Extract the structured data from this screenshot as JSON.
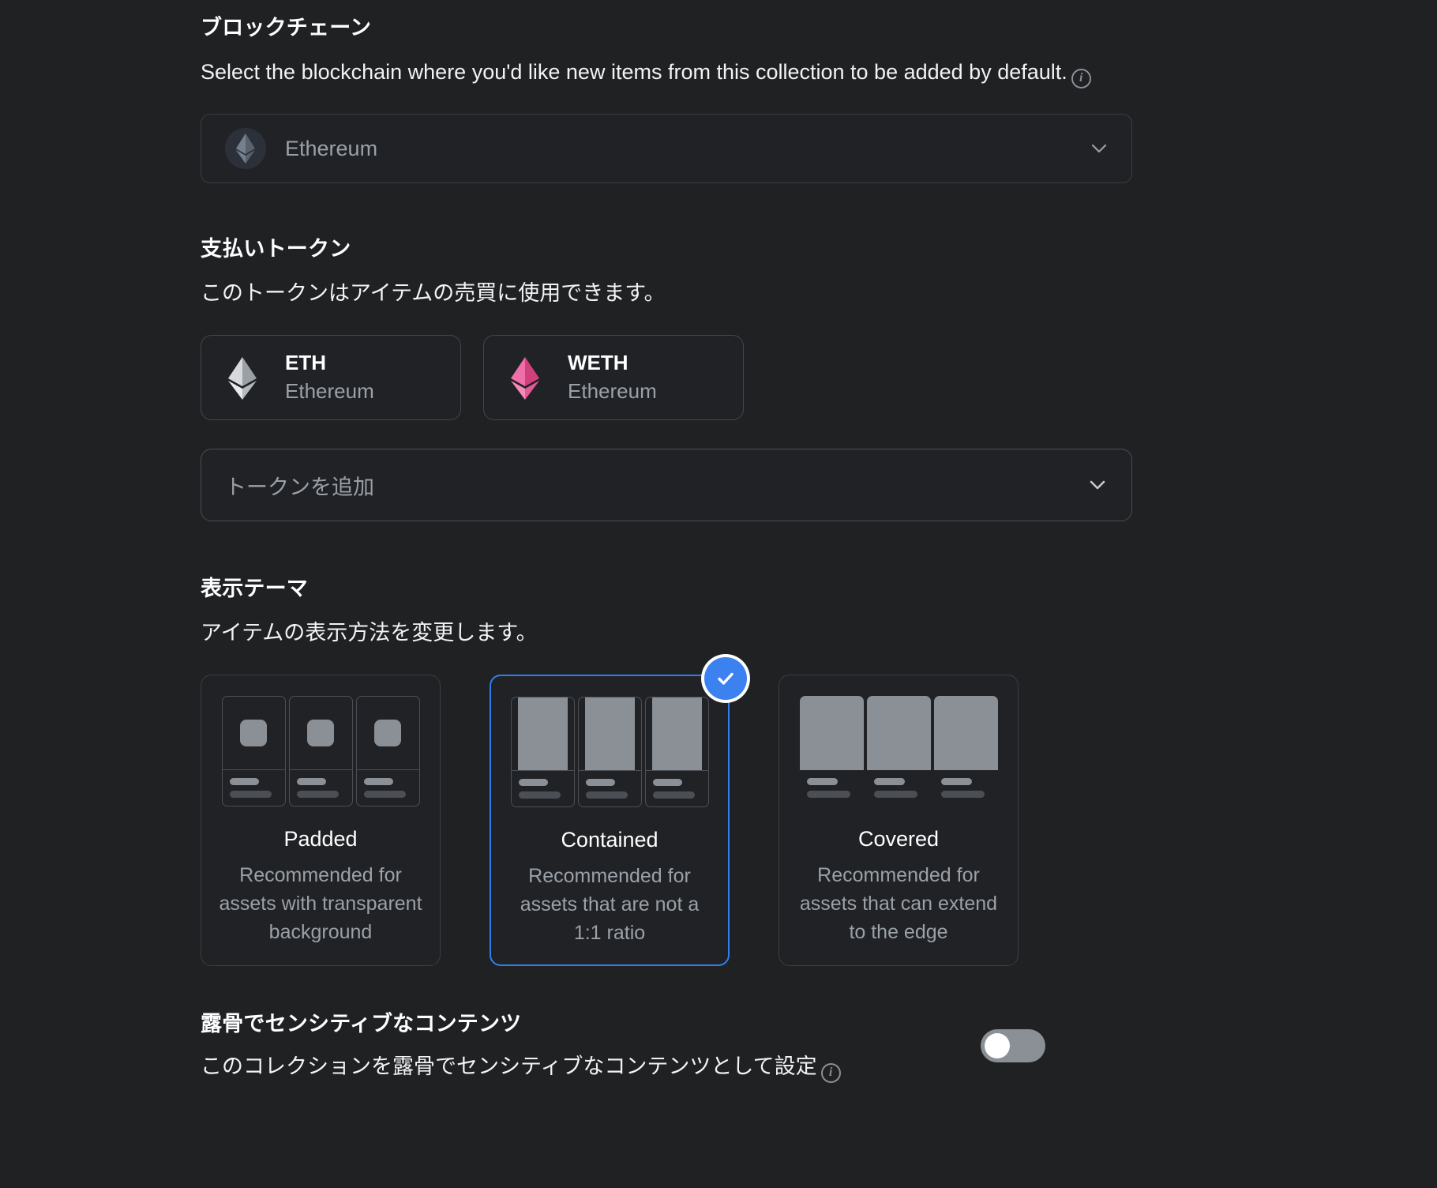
{
  "blockchain": {
    "title": "ブロックチェーン",
    "description": "Select the blockchain where you'd like new items from this collection to be added by default.",
    "info_glyph": "i",
    "selected": "Ethereum",
    "chevron": "chevron-down"
  },
  "payment_tokens": {
    "title": "支払いトークン",
    "description": "このトークンはアイテムの売買に使用できます。",
    "tokens": [
      {
        "symbol": "ETH",
        "chain": "Ethereum",
        "icon": "ethereum-diamond-icon",
        "color": "#c9ccd1"
      },
      {
        "symbol": "WETH",
        "chain": "Ethereum",
        "icon": "wrapped-ethereum-diamond-icon",
        "color": "#e04a8e"
      }
    ],
    "add_placeholder": "トークンを追加"
  },
  "display_theme": {
    "title": "表示テーマ",
    "description": "アイテムの表示方法を変更します。",
    "selected_index": 1,
    "selected_accent": "#2f80ed",
    "options": [
      {
        "name": "Padded",
        "description": "Recommended for assets with transparent background",
        "variant": "padded"
      },
      {
        "name": "Contained",
        "description": "Recommended for assets that are not a 1:1 ratio",
        "variant": "contained"
      },
      {
        "name": "Covered",
        "description": "Recommended for assets that can extend to the edge",
        "variant": "covered"
      }
    ]
  },
  "explicit_content": {
    "title": "露骨でセンシティブなコンテンツ",
    "description": "このコレクションを露骨でセンシティブなコンテンツとして設定",
    "info_glyph": "i",
    "toggle_on": false
  }
}
